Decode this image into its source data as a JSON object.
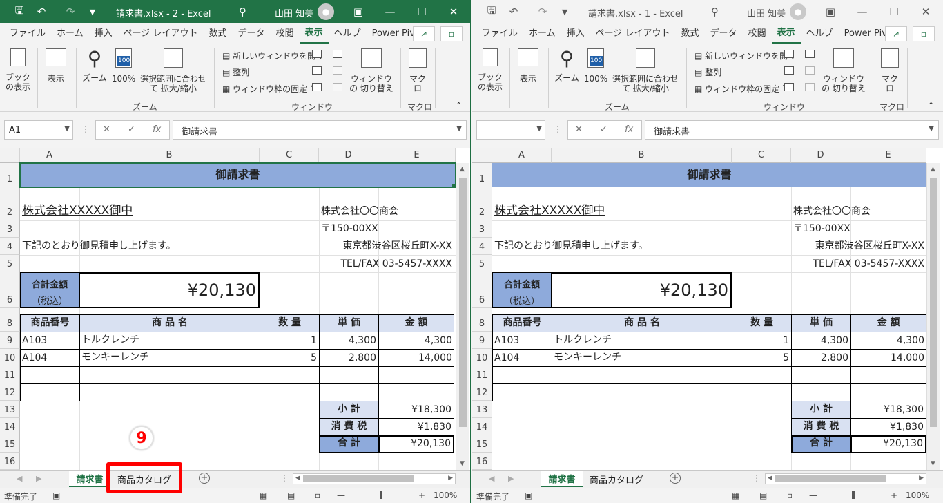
{
  "windows": [
    {
      "title": "請求書.xlsx  -  2  -  Excel",
      "user": "山田 知美",
      "name_box": "A1",
      "formula": "御請求書"
    },
    {
      "title": "請求書.xlsx  -  1  -  Excel",
      "user": "山田 知美",
      "name_box": "",
      "formula": "御請求書"
    }
  ],
  "ribbon": {
    "tabs": [
      "ファイル",
      "ホーム",
      "挿入",
      "ページ レイアウト",
      "数式",
      "データ",
      "校閲",
      "表示",
      "ヘルプ",
      "Power Pivot"
    ],
    "active_tab": "表示",
    "book_view": "ブックの表示",
    "show": "表示",
    "zoom": "ズーム",
    "zoom100": "100%",
    "zoom_selection": "選択範囲に合わせて 拡大/縮小",
    "zoom_group": "ズーム",
    "new_window": "新しいウィンドウを開く",
    "arrange": "整列",
    "freeze": "ウィンドウ枠の固定",
    "switch_windows": "ウィンドウの 切り替え",
    "window_group": "ウィンドウ",
    "macro": "マクロ",
    "macro_group": "マクロ",
    "icon_100": "100"
  },
  "columns": [
    "A",
    "B",
    "C",
    "D",
    "E"
  ],
  "rows": [
    "1",
    "2",
    "3",
    "4",
    "5",
    "6",
    "8",
    "9",
    "10",
    "11",
    "12",
    "13",
    "14",
    "15",
    "16"
  ],
  "sheet": {
    "title": "御請求書",
    "client": "株式会社XXXXX御中",
    "company": "株式会社〇〇商会",
    "postal": "〒150-00XX",
    "address": "東京都渋谷区桜丘町X-XX",
    "tel": "TEL/FAX 03-5457-XXXX",
    "intro": "下記のとおり御見積申し上げます。",
    "total_label_1": "合計金額",
    "total_label_2": "（税込）",
    "total_amount": "¥20,130",
    "headers": [
      "商品番号",
      "商 品 名",
      "数 量",
      "単 価",
      "金 額"
    ],
    "items": [
      {
        "code": "A103",
        "name": "トルクレンチ",
        "qty": "1",
        "price": "4,300",
        "amount": "4,300"
      },
      {
        "code": "A104",
        "name": "モンキーレンチ",
        "qty": "5",
        "price": "2,800",
        "amount": "14,000"
      }
    ],
    "subtotal_label": "小 計",
    "subtotal": "¥18,300",
    "tax_label": "消 費 税",
    "tax": "¥1,830",
    "total_label": "合 計",
    "total": "¥20,130"
  },
  "sheet_tabs": [
    "請求書",
    "商品カタログ"
  ],
  "status": {
    "ready": "準備完了",
    "zoom": "100%"
  },
  "annotation": {
    "step": "9"
  },
  "colors": {
    "excel_green": "#217346",
    "title_fill": "#8eaadb",
    "header_fill": "#d9e1f2",
    "highlight": "#ff0000"
  }
}
